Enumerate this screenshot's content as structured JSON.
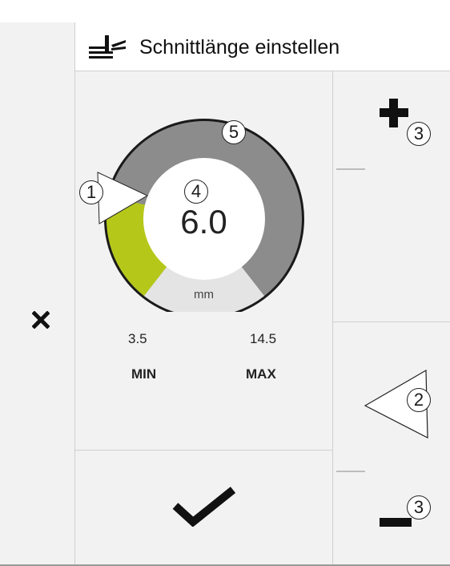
{
  "header": {
    "title": "Schnittlänge einstellen",
    "icon": "cut-length-icon"
  },
  "gauge": {
    "value": "6.0",
    "unit": "mm",
    "min_value": "3.5",
    "max_value": "14.5",
    "min_label": "MIN",
    "max_label": "MAX",
    "level_fraction": 0.23
  },
  "callouts": {
    "c1": "1",
    "c2": "2",
    "c3a": "3",
    "c3b": "3",
    "c4": "4",
    "c5": "5"
  },
  "colors": {
    "accent": "#b5c81a",
    "track": "#8c8c8c",
    "unit_band": "#e4e4e4",
    "background": "#f2f2f2"
  },
  "buttons": {
    "close": "close-icon",
    "confirm": "checkmark-icon",
    "increase": "plus-icon",
    "decrease": "minus-icon",
    "pointer": "triangle-pointer-icon"
  }
}
